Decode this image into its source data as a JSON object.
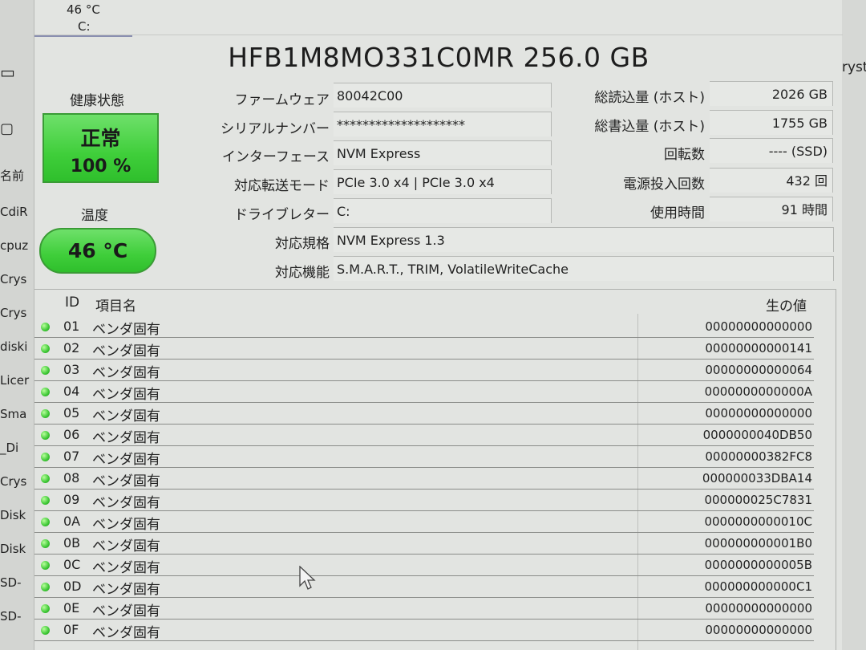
{
  "background_left": [
    "名前",
    "CdiR",
    "cpuz",
    "Crys",
    "Crys",
    "diski",
    "Licer",
    "Sma",
    "_Di",
    "Crys",
    "Disk",
    "Disk",
    "SD-",
    "SD-"
  ],
  "background_right": "ryst",
  "temp_tab": {
    "value": "46 °C",
    "drive": "C:"
  },
  "model_title": "HFB1M8MO331C0MR 256.0 GB",
  "health": {
    "label": "健康状態",
    "status": "正常",
    "percent": "100 %"
  },
  "temperature": {
    "label": "温度",
    "value": "46 °C"
  },
  "info_left": {
    "firmware": {
      "label": "ファームウェア",
      "value": "80042C00"
    },
    "serial": {
      "label": "シリアルナンバー",
      "value": "********************"
    },
    "interface": {
      "label": "インターフェース",
      "value": "NVM Express"
    },
    "transfer": {
      "label": "対応転送モード",
      "value": "PCIe 3.0 x4 | PCIe 3.0 x4"
    },
    "drive_letter": {
      "label": "ドライブレター",
      "value": "C:"
    },
    "standard": {
      "label": "対応規格",
      "value": "NVM Express 1.3"
    },
    "features": {
      "label": "対応機能",
      "value": "S.M.A.R.T., TRIM, VolatileWriteCache"
    }
  },
  "info_right": {
    "host_reads": {
      "label": "総読込量 (ホスト)",
      "value": "2026 GB"
    },
    "host_writes": {
      "label": "総書込量 (ホスト)",
      "value": "1755 GB"
    },
    "rotation": {
      "label": "回転数",
      "value": "---- (SSD)"
    },
    "power_on_count": {
      "label": "電源投入回数",
      "value": "432 回"
    },
    "power_on_hours": {
      "label": "使用時間",
      "value": "91 時間"
    }
  },
  "table": {
    "headers": {
      "id": "ID",
      "name": "項目名",
      "raw": "生の値"
    },
    "rows": [
      {
        "id": "01",
        "name": "ベンダ固有",
        "raw": "00000000000000"
      },
      {
        "id": "02",
        "name": "ベンダ固有",
        "raw": "00000000000141"
      },
      {
        "id": "03",
        "name": "ベンダ固有",
        "raw": "00000000000064"
      },
      {
        "id": "04",
        "name": "ベンダ固有",
        "raw": "0000000000000A"
      },
      {
        "id": "05",
        "name": "ベンダ固有",
        "raw": "00000000000000"
      },
      {
        "id": "06",
        "name": "ベンダ固有",
        "raw": "0000000040DB50"
      },
      {
        "id": "07",
        "name": "ベンダ固有",
        "raw": "00000000382FC8"
      },
      {
        "id": "08",
        "name": "ベンダ固有",
        "raw": "000000033DBA14"
      },
      {
        "id": "09",
        "name": "ベンダ固有",
        "raw": "000000025C7831"
      },
      {
        "id": "0A",
        "name": "ベンダ固有",
        "raw": "0000000000010C"
      },
      {
        "id": "0B",
        "name": "ベンダ固有",
        "raw": "000000000001B0"
      },
      {
        "id": "0C",
        "name": "ベンダ固有",
        "raw": "0000000000005B"
      },
      {
        "id": "0D",
        "name": "ベンダ固有",
        "raw": "000000000000C1"
      },
      {
        "id": "0E",
        "name": "ベンダ固有",
        "raw": "00000000000000"
      },
      {
        "id": "0F",
        "name": "ベンダ固有",
        "raw": "00000000000000"
      }
    ]
  },
  "colors": {
    "good": "#3fce3a",
    "window_bg": "#e2e4e1"
  }
}
